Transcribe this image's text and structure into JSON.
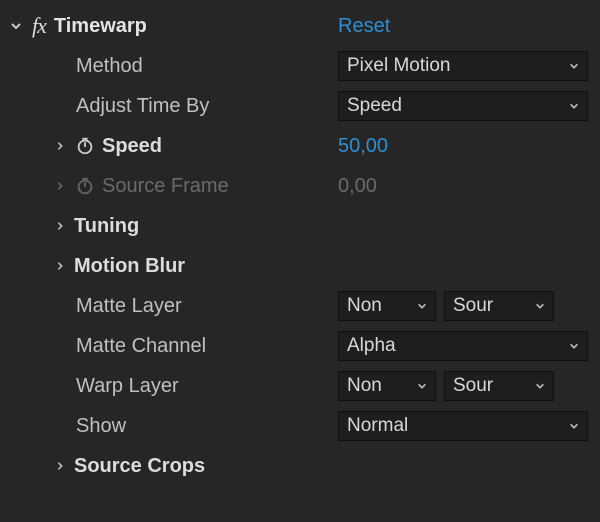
{
  "effect": {
    "name": "Timewarp",
    "fx_badge": "fx",
    "reset": "Reset",
    "props": {
      "method": {
        "label": "Method",
        "value": "Pixel Motion"
      },
      "adjust_time_by": {
        "label": "Adjust Time By",
        "value": "Speed"
      },
      "speed": {
        "label": "Speed",
        "value": "50,00"
      },
      "source_frame": {
        "label": "Source Frame",
        "value": "0,00"
      },
      "tuning": {
        "label": "Tuning"
      },
      "motion_blur": {
        "label": "Motion Blur"
      },
      "matte_layer": {
        "label": "Matte Layer",
        "value_a": "Non",
        "value_b": "Sour"
      },
      "matte_channel": {
        "label": "Matte Channel",
        "value": "Alpha"
      },
      "warp_layer": {
        "label": "Warp Layer",
        "value_a": "Non",
        "value_b": "Sour"
      },
      "show": {
        "label": "Show",
        "value": "Normal"
      },
      "source_crops": {
        "label": "Source Crops"
      }
    }
  }
}
